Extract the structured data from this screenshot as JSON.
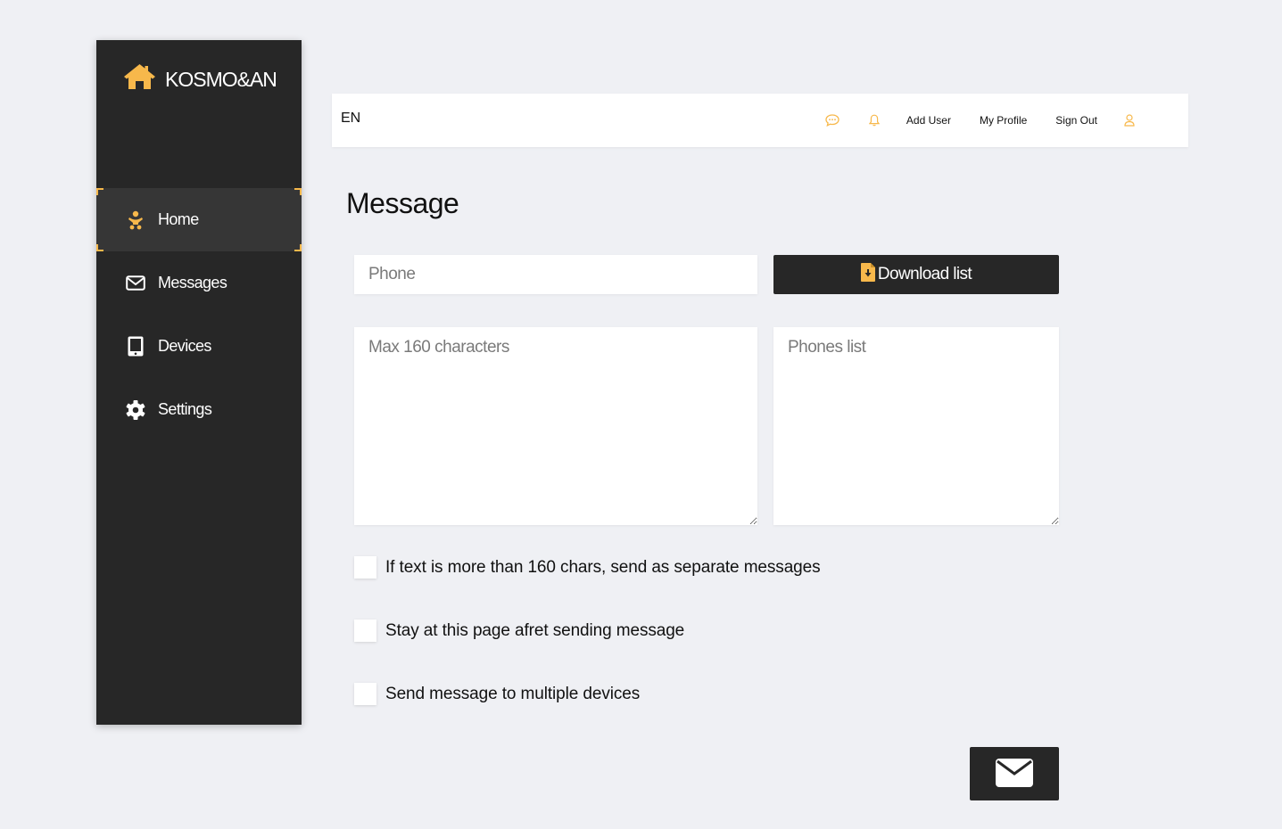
{
  "brand": {
    "name": "KOSMO&AN",
    "icon": "home-icon"
  },
  "colors": {
    "accent": "#f7b84b",
    "sidebar_bg": "#272727",
    "page_bg": "#eff0f4"
  },
  "sidebar": {
    "items": [
      {
        "label": "Home",
        "icon": "baby-icon",
        "active": true
      },
      {
        "label": "Messages",
        "icon": "envelope-icon"
      },
      {
        "label": "Devices",
        "icon": "tablet-icon"
      },
      {
        "label": "Settings",
        "icon": "gear-icon"
      }
    ]
  },
  "topbar": {
    "language": "EN",
    "links": {
      "add_user": "Add User",
      "my_profile": "My Profile",
      "sign_out": "Sign Out"
    }
  },
  "main": {
    "title": "Message",
    "phone_placeholder": "Phone",
    "download_label": "Download list",
    "message_placeholder": "Max 160 characters",
    "phones_list_placeholder": "Phones list",
    "checkboxes": [
      {
        "label": "If text is more than 160 chars, send as separate messages",
        "checked": false
      },
      {
        "label": "Stay at this page afret sending message",
        "checked": false
      },
      {
        "label": "Send message to multiple devices",
        "checked": false
      }
    ],
    "send_icon": "envelope-icon"
  }
}
